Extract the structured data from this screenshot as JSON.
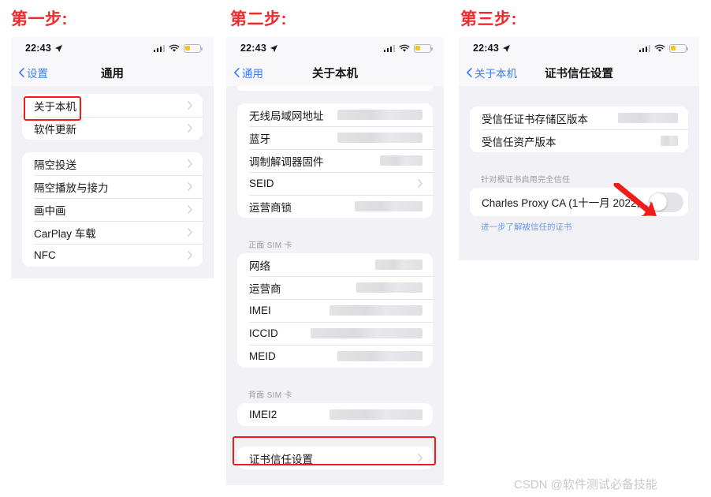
{
  "steps": {
    "one": "第一步:",
    "two": "第二步:",
    "three": "第三步:"
  },
  "status_bar": {
    "time": "22:43",
    "location_icon": "location-arrow-icon",
    "signal_icon": "cellular-bars-icon",
    "wifi_icon": "wifi-icon",
    "battery_icon": "battery-low-icon"
  },
  "panel1": {
    "nav": {
      "back_label": "设置",
      "title": "通用",
      "back_icon": "chevron-left-icon"
    },
    "group_a": [
      {
        "label": "关于本机",
        "accessory": "chevron-right-icon",
        "highlighted": true
      },
      {
        "label": "软件更新",
        "accessory": "chevron-right-icon"
      }
    ],
    "group_b": [
      {
        "label": "隔空投送",
        "accessory": "chevron-right-icon"
      },
      {
        "label": "隔空播放与接力",
        "accessory": "chevron-right-icon"
      },
      {
        "label": "画中画",
        "accessory": "chevron-right-icon"
      },
      {
        "label": "CarPlay 车载",
        "accessory": "chevron-right-icon"
      },
      {
        "label": "NFC",
        "accessory": "chevron-right-icon"
      }
    ]
  },
  "panel2": {
    "nav": {
      "back_label": "通用",
      "title": "关于本机",
      "back_icon": "chevron-left-icon"
    },
    "group_a": [
      {
        "label": "无线局域网地址",
        "value": "redacted",
        "redact_width": 108
      },
      {
        "label": "蓝牙",
        "value": "redacted",
        "redact_width": 108
      },
      {
        "label": "调制解调器固件",
        "value": "redacted",
        "redact_width": 54
      },
      {
        "label": "SEID",
        "accessory": "chevron-right-icon"
      },
      {
        "label": "运营商锁",
        "value": "redacted",
        "redact_width": 86
      }
    ],
    "section_front": "正面 SIM 卡",
    "group_b": [
      {
        "label": "网络",
        "value": "redacted",
        "redact_width": 60
      },
      {
        "label": "运营商",
        "value": "redacted",
        "redact_width": 84
      },
      {
        "label": "IMEI",
        "value": "redacted",
        "redact_width": 118
      },
      {
        "label": "ICCID",
        "value": "redacted",
        "redact_width": 142
      },
      {
        "label": "MEID",
        "value": "redacted",
        "redact_width": 108
      }
    ],
    "section_back": "背面 SIM 卡",
    "group_c": [
      {
        "label": "IMEI2",
        "value": "redacted",
        "redact_width": 118
      }
    ],
    "group_d": [
      {
        "label": "证书信任设置",
        "accessory": "chevron-right-icon",
        "highlighted": true
      }
    ]
  },
  "panel3": {
    "nav": {
      "back_label": "关于本机",
      "title": "证书信任设置",
      "back_icon": "chevron-left-icon"
    },
    "group_a": [
      {
        "label": "受信任证书存储区版本",
        "value": "redacted",
        "redact_width": 76
      },
      {
        "label": "受信任资产版本",
        "value": "redacted",
        "redact_width": 22
      }
    ],
    "section_root": "针对根证书启用完全信任",
    "cert": {
      "label": "Charles Proxy CA (1十一月 2022,...",
      "toggle_state": "off",
      "toggle_name": "certificate-trust-toggle"
    },
    "learn_more": "进一步了解被信任的证书",
    "arrow_icon": "red-pointer-arrow-icon"
  },
  "watermark": "CSDN @软件测试必备技能",
  "colors": {
    "accent_red": "#f01c1c",
    "link_blue": "#3b7cf0",
    "page_bg": "#f2f1f6",
    "card_bg": "#ffffff",
    "battery_yellow": "#f5c518"
  }
}
